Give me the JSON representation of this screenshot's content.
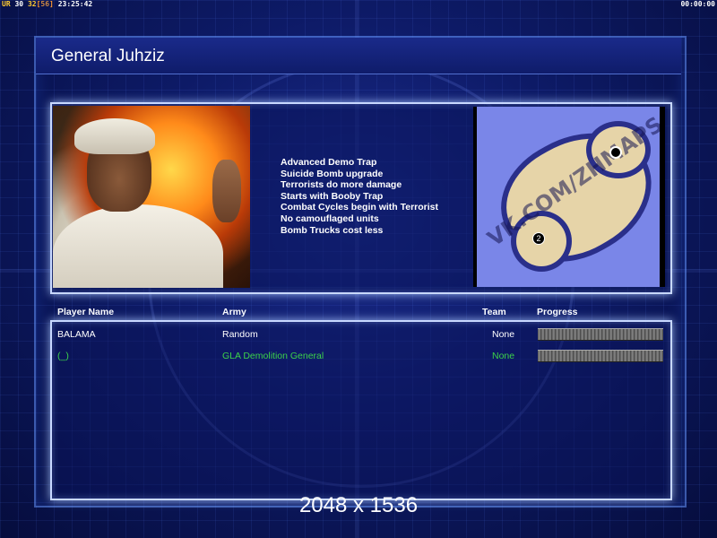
{
  "topbar": {
    "ur": "UR",
    "n30": "30",
    "n32": "32",
    "bracket_open": "[",
    "n56": "56",
    "bracket_close": "]",
    "time": "23:25:42",
    "clock_right": "00:00:00"
  },
  "title": "General Juhziz",
  "features": [
    "Advanced Demo Trap",
    "Suicide Bomb upgrade",
    "Terrorists do more damage",
    "Starts with Booby Trap",
    "Combat Cycles begin with Terrorist",
    "No camouflaged units",
    "Bomb Trucks cost less"
  ],
  "map": {
    "watermark": "VK.COM/ZHMAPS",
    "start_label": "2"
  },
  "columns": {
    "player_name": "Player Name",
    "army": "Army",
    "team": "Team",
    "progress": "Progress"
  },
  "players": [
    {
      "name": "BALAMA",
      "army": "Random",
      "team": "None",
      "progress": 1.0
    },
    {
      "name": "(_)",
      "army": "GLA Demolition General",
      "team": "None",
      "progress": 1.0
    }
  ],
  "resolution": "2048 x 1536",
  "colors": {
    "background": "#0d1a66",
    "panel_border": "#c8d8ff",
    "local_player": "#3cd24a"
  }
}
